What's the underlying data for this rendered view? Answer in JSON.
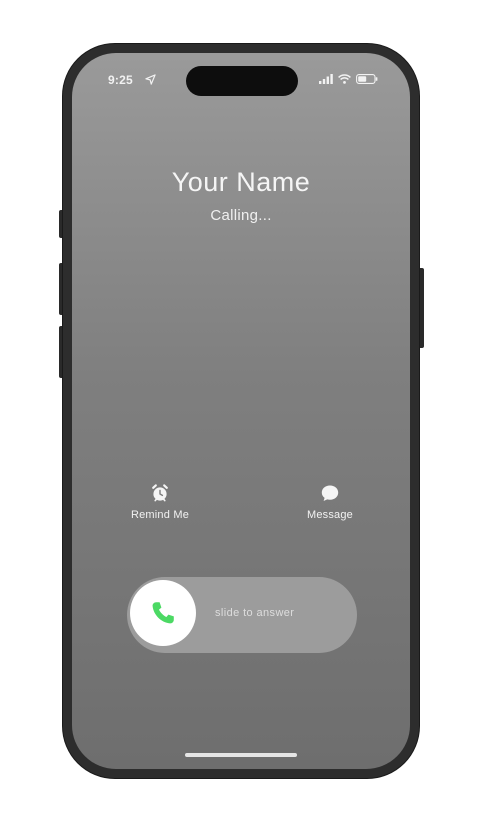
{
  "status_bar": {
    "time": "9:25",
    "location_icon": "location-arrow-icon",
    "signal_icon": "cellular-signal-icon",
    "wifi_icon": "wifi-icon",
    "battery_icon": "battery-icon"
  },
  "call": {
    "caller_name": "Your Name",
    "status": "Calling..."
  },
  "actions": {
    "remind": {
      "label": "Remind Me",
      "icon": "alarm-clock-icon"
    },
    "message": {
      "label": "Message",
      "icon": "message-bubble-icon"
    }
  },
  "slider": {
    "text": "slide to answer",
    "icon": "phone-icon",
    "accent_color": "#4cd964"
  }
}
